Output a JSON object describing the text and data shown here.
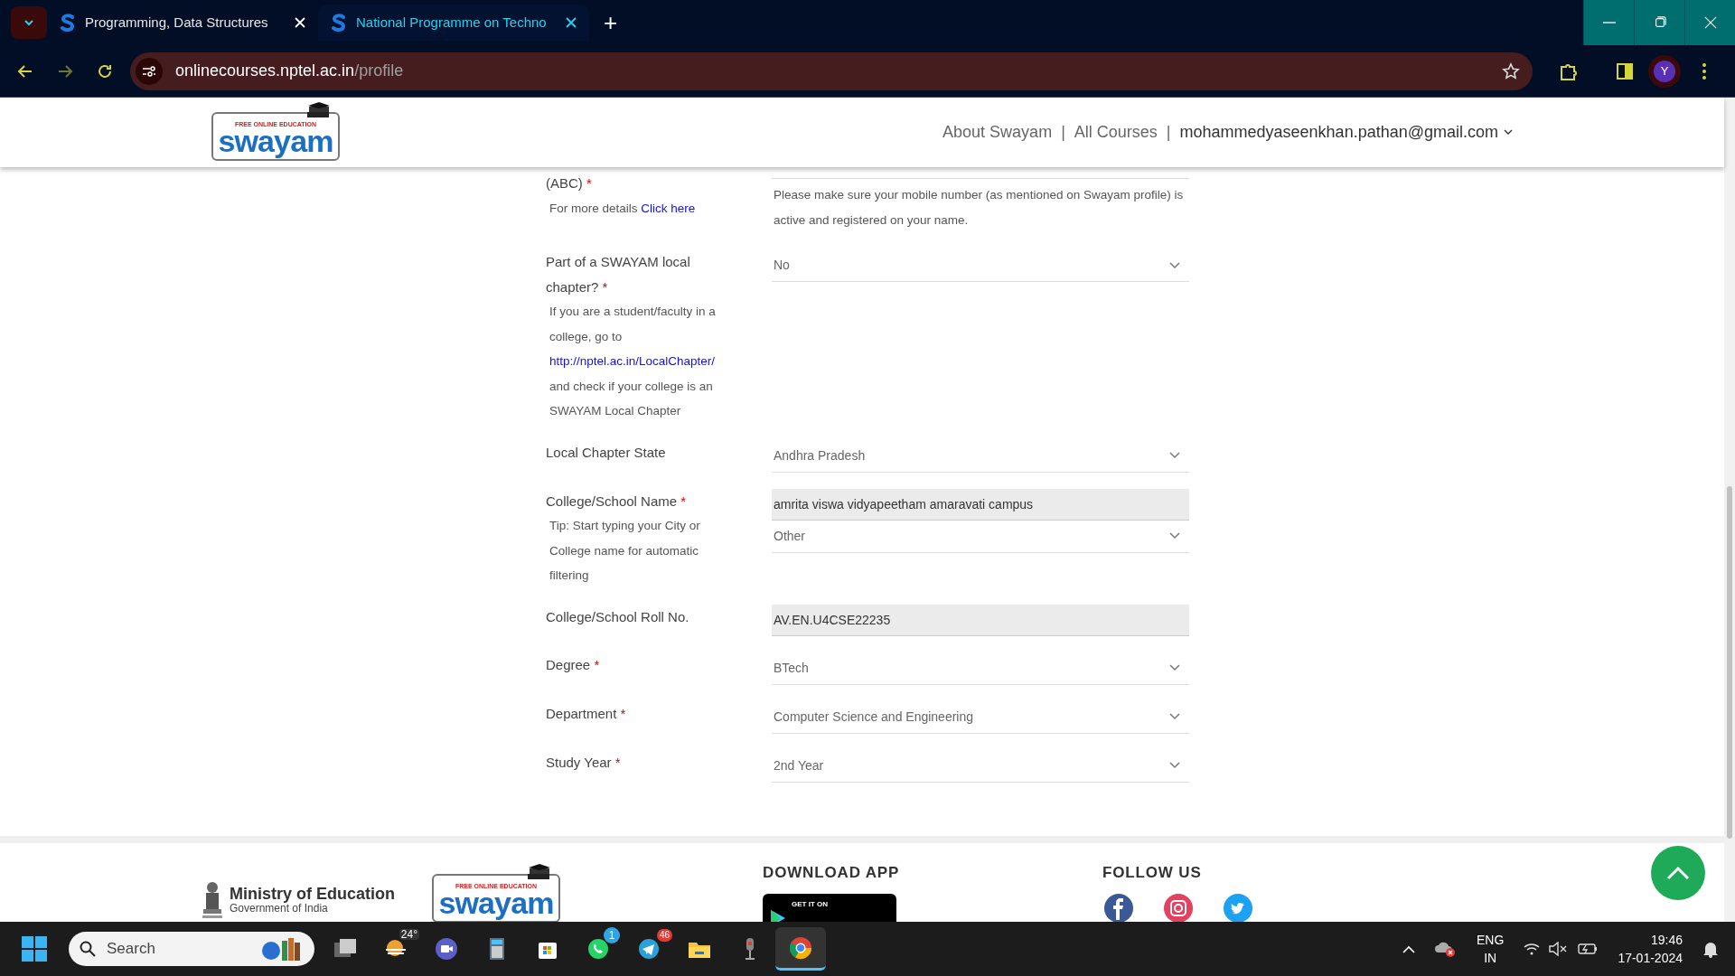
{
  "browser": {
    "tabs": [
      {
        "title": "Programming, Data Structures",
        "selected": false
      },
      {
        "title": "National Programme on Techno",
        "selected": true
      }
    ],
    "new_tab": "+",
    "url_host": "onlinecourses.nptel.ac.in",
    "url_path": "/profile",
    "profile_initial": "Y"
  },
  "header": {
    "logo": {
      "tagline": "FREE ONLINE EDUCATION",
      "name": "swayam"
    },
    "nav": [
      "About Swayam",
      "All Courses"
    ],
    "separators": [
      "|",
      "|"
    ],
    "account": "mohammedyaseenkhan.pathan@gmail.com"
  },
  "form": {
    "required_mark": "*",
    "rows": [
      {
        "label": "(ABC)",
        "required": true,
        "help": [
          [
            {
              "text": "For more details "
            },
            {
              "link": "Click here"
            }
          ]
        ],
        "fields": [
          {
            "kind": "note",
            "value": "Please make sure your mobile number (as mentioned on Swayam profile) is active and registered on your name."
          }
        ]
      },
      {
        "label": "Part of a SWAYAM local chapter?",
        "required": true,
        "help": [
          [
            {
              "text": "If you are a student/faculty in a college, go to"
            }
          ],
          [
            {
              "link": "http://nptel.ac.in/LocalChapter/"
            }
          ],
          [
            {
              "text": "and check if your college is an SWAYAM Local Chapter"
            }
          ]
        ],
        "fields": [
          {
            "kind": "select",
            "value": "No"
          }
        ]
      },
      {
        "label": "Local Chapter State",
        "required": false,
        "fields": [
          {
            "kind": "select",
            "value": "Andhra Pradesh"
          }
        ]
      },
      {
        "label": "College/School Name",
        "required": true,
        "help": [
          [
            {
              "text": "Tip: Start typing your City or College name for automatic filtering"
            }
          ]
        ],
        "fields": [
          {
            "kind": "input",
            "value": "amrita viswa vidyapeetham amaravati campus"
          },
          {
            "kind": "select",
            "value": "Other"
          }
        ]
      },
      {
        "label": "College/School Roll No.",
        "required": false,
        "fields": [
          {
            "kind": "input",
            "value": "AV.EN.U4CSE22235"
          }
        ]
      },
      {
        "label": "Degree",
        "required": true,
        "fields": [
          {
            "kind": "select",
            "value": "BTech"
          }
        ]
      },
      {
        "label": "Department",
        "required": true,
        "fields": [
          {
            "kind": "select",
            "value": "Computer Science and Engineering"
          }
        ]
      },
      {
        "label": "Study Year",
        "required": true,
        "fields": [
          {
            "kind": "select",
            "value": "2nd Year"
          }
        ]
      }
    ]
  },
  "footer": {
    "ministry": {
      "name": "Ministry of Education",
      "sub": "Government of India"
    },
    "logo": {
      "tagline": "FREE ONLINE EDUCATION",
      "name": "swayam"
    },
    "download_title": "DOWNLOAD APP",
    "badge_caption": "GET IT ON",
    "follow_title": "FOLLOW US"
  },
  "taskbar": {
    "search_placeholder": "Search",
    "weather": "24°",
    "whatsapp_badge": "1",
    "telegram_badge": "46",
    "language": "ENG",
    "region": "IN",
    "time": "19:46",
    "date": "17-01-2024"
  }
}
